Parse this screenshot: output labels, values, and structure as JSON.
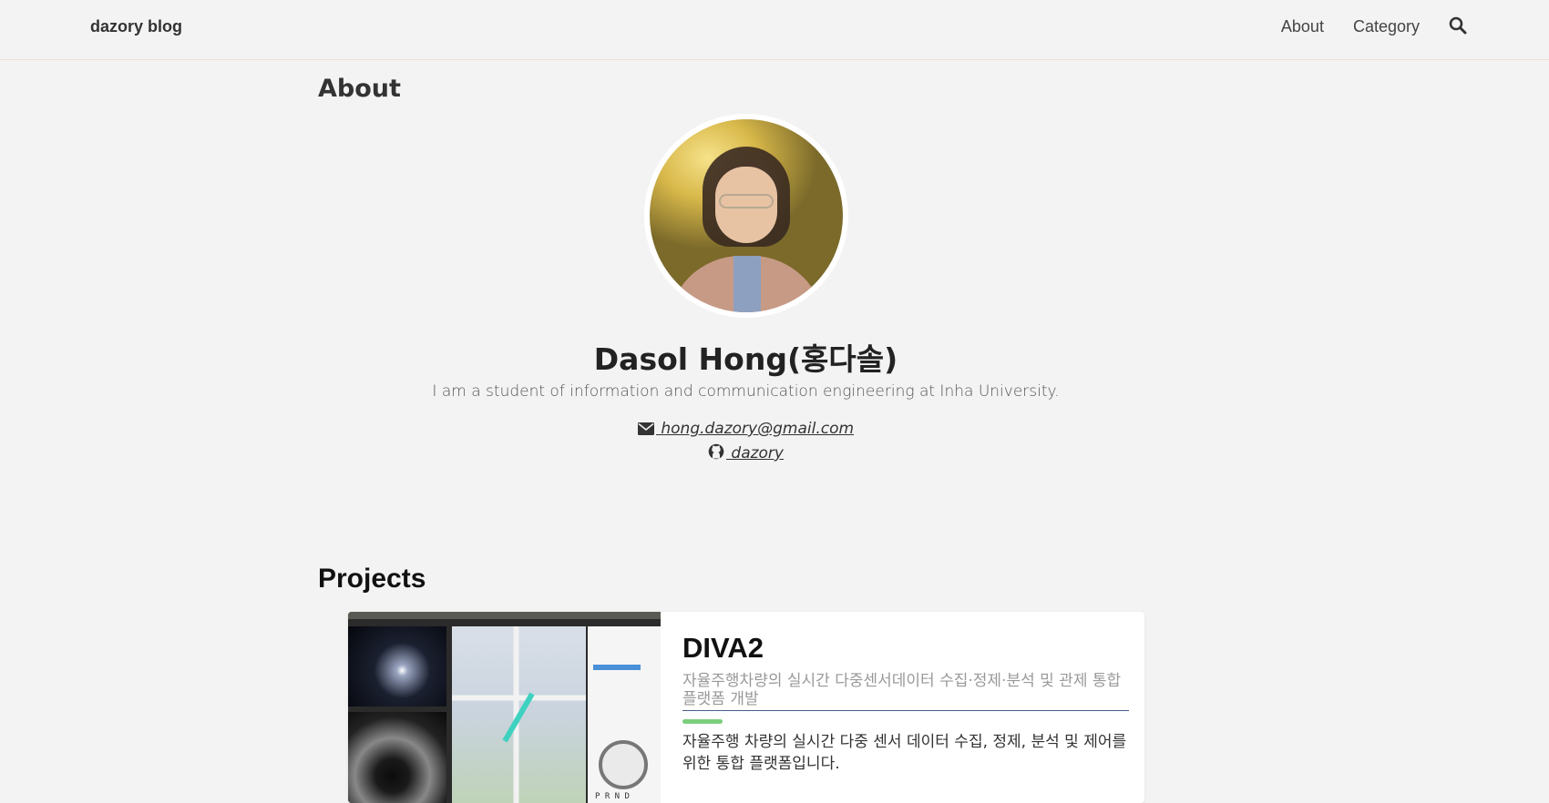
{
  "header": {
    "brand": "dazory blog",
    "nav": [
      {
        "label": "About"
      },
      {
        "label": "Category"
      }
    ],
    "search_icon": "search-icon"
  },
  "about": {
    "title": "About",
    "name": "Dasol Hong(홍다솔)",
    "bio": "I am a student of information and communication engineering at Inha University.",
    "email": " hong.dazory@gmail.com",
    "github": " dazory",
    "email_icon": "envelope-icon",
    "github_icon": "github-icon"
  },
  "projects": {
    "title": "Projects",
    "items": [
      {
        "title": "DIVA2",
        "subtitle": "자율주행차량의 실시간 다중센서데이터 수집·정제·분석 및 관제 통합 플랫폼 개발",
        "description": "자율주행 차량의 실시간 다중 센서 데이터 수집, 정제, 분석 및 제어를 위한 통합 플랫폼입니다.",
        "thumbnail_gear": "P R N D",
        "accent_color": "#7cce7c"
      }
    ]
  }
}
